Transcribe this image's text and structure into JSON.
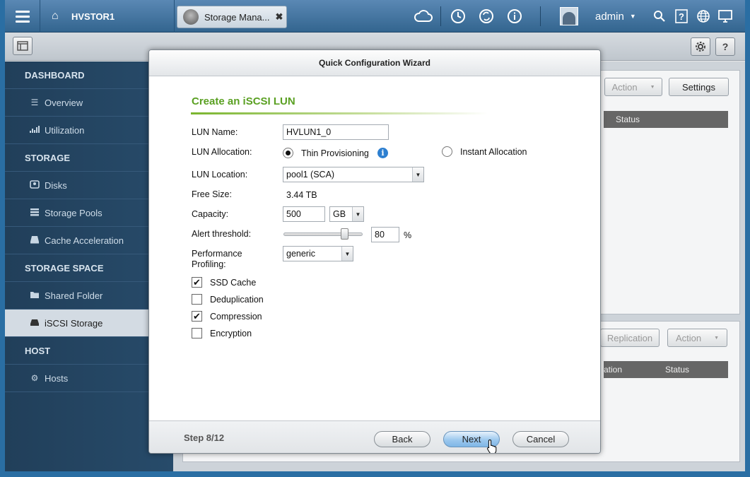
{
  "topbar": {
    "nas_name": "HVSTOR1",
    "app_tab_label": "Storage Mana...",
    "app_tab_close": "✖",
    "user_name": "admin",
    "caret": "▼"
  },
  "sidebar": {
    "sections": [
      {
        "label": "DASHBOARD",
        "items": [
          {
            "label": "Overview",
            "icon": "list-icon"
          },
          {
            "label": "Utilization",
            "icon": "chart-icon"
          }
        ]
      },
      {
        "label": "STORAGE",
        "items": [
          {
            "label": "Disks",
            "icon": "disk-icon"
          },
          {
            "label": "Storage Pools",
            "icon": "pools-icon"
          },
          {
            "label": "Cache Acceleration",
            "icon": "cache-icon"
          }
        ]
      },
      {
        "label": "STORAGE SPACE",
        "items": [
          {
            "label": "Shared Folder",
            "icon": "folder-icon"
          },
          {
            "label": "iSCSI Storage",
            "icon": "iscsi-icon"
          }
        ]
      },
      {
        "label": "HOST",
        "items": [
          {
            "label": "Hosts",
            "icon": "gear-icon"
          }
        ]
      }
    ]
  },
  "background": {
    "top_action_label": "Action",
    "settings_label": "Settings",
    "top_status_header": "Status",
    "replication_label": "Replication",
    "bottom_action_label": "Action",
    "bottom_col_partial": "ation",
    "bottom_status_header": "Status"
  },
  "wizard": {
    "title": "Quick Configuration Wizard",
    "heading": "Create an iSCSI LUN",
    "lun_name_label": "LUN Name:",
    "lun_name_value": "HVLUN1_0",
    "allocation_label": "LUN Allocation:",
    "thin_label": "Thin Provisioning",
    "instant_label": "Instant Allocation",
    "allocation_selected": "thin",
    "location_label": "LUN Location:",
    "location_value": "pool1 (SCA)",
    "free_size_label": "Free Size:",
    "free_size_value": "3.44 TB",
    "capacity_label": "Capacity:",
    "capacity_value": "500",
    "capacity_unit": "GB",
    "alert_label": "Alert threshold:",
    "alert_value": "80",
    "alert_unit": "%",
    "alert_fraction": 0.8,
    "profiling_label_1": "Performance",
    "profiling_label_2": "Profiling:",
    "profiling_value": "generic",
    "options": [
      {
        "label": "SSD Cache",
        "checked": true
      },
      {
        "label": "Deduplication",
        "checked": false
      },
      {
        "label": "Compression",
        "checked": true
      },
      {
        "label": "Encryption",
        "checked": false
      }
    ],
    "step": "Step 8/12",
    "back_label": "Back",
    "next_label": "Next",
    "cancel_label": "Cancel"
  },
  "colors": {
    "accent_green": "#5aa022",
    "topbar_blue": "#33658f",
    "sidebar_bg": "#213f5a",
    "info_blue": "#2d7fd0"
  }
}
